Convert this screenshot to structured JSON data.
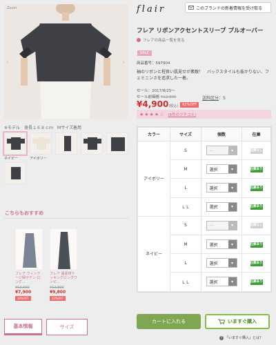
{
  "gallery": {
    "zoom_label": "Zoom",
    "model_note": "※モデル　身長１６８ｃｍ　Mサイズ着用",
    "thumb_labels": [
      "ネイビー",
      "アイボリー"
    ]
  },
  "recommend": {
    "title": "こちらもおすすめ",
    "items": [
      {
        "name": "フレア ウィンテージ柄サテン ロング...",
        "old_price": "¥13,000",
        "price": "¥7,900",
        "badge": "39%OFF"
      },
      {
        "name": "フレア 異素材ドッキングロングワンピ...",
        "old_price": "¥12,800",
        "price": "¥9,800",
        "badge": "23%OFF"
      }
    ]
  },
  "tabs": [
    "基本情報",
    "サイズ"
  ],
  "header": {
    "brand": "flair",
    "follow_label": "このブランドの新着情報を受け取る"
  },
  "product": {
    "title": "フレア リボンアクセントスリーブ プルオーバー",
    "brand_link": "フレアの商品一覧を見る",
    "sale_badge": "SALE",
    "number": "商品番号：597904",
    "description": "袖のリボンと程良い肌見せが素敵！　バックスタイルも抜かりない、フェミニンさを追求した一着。",
    "sale_period": "セール：2017/8/25～",
    "pre_price_label": "セール前価格 ",
    "pre_price": "¥12,900",
    "price": "¥4,900",
    "tax": "(税込)",
    "off": "62%OFF",
    "shipping_link": "送料区分",
    "shipping_value": "：S",
    "stars": "★★★★☆",
    "review_count": "(6件のクチコミ)"
  },
  "stock_table": {
    "headers": [
      "カラー",
      "サイズ",
      "個数",
      "在庫"
    ],
    "groups": [
      {
        "color": "アイボリー",
        "rows": [
          {
            "size": "S",
            "qty": "---",
            "stock": "在庫なし",
            "available": false
          },
          {
            "size": "M",
            "qty": "選択",
            "stock": "在庫あり",
            "available": true
          },
          {
            "size": "L",
            "qty": "選択",
            "stock": "在庫あり",
            "available": true
          },
          {
            "size": "ＬＬ",
            "qty": "選択",
            "stock": "在庫あり",
            "available": true
          }
        ]
      },
      {
        "color": "ネイビー",
        "rows": [
          {
            "size": "S",
            "qty": "---",
            "stock": "在庫なし",
            "available": false
          },
          {
            "size": "M",
            "qty": "選択",
            "stock": "在庫あり",
            "available": true
          },
          {
            "size": "L",
            "qty": "選択",
            "stock": "在庫あり",
            "available": true
          },
          {
            "size": "ＬＬ",
            "qty": "選択",
            "stock": "在庫あり",
            "available": true
          }
        ]
      }
    ]
  },
  "actions": {
    "cart": "カートに入れる",
    "buy_now": "いますぐ購入",
    "help": "「いますぐ購入」とは？"
  },
  "colors": {
    "accent": "#cc6f8f",
    "price": "#cc2e2e",
    "green": "#3f9e3a"
  }
}
